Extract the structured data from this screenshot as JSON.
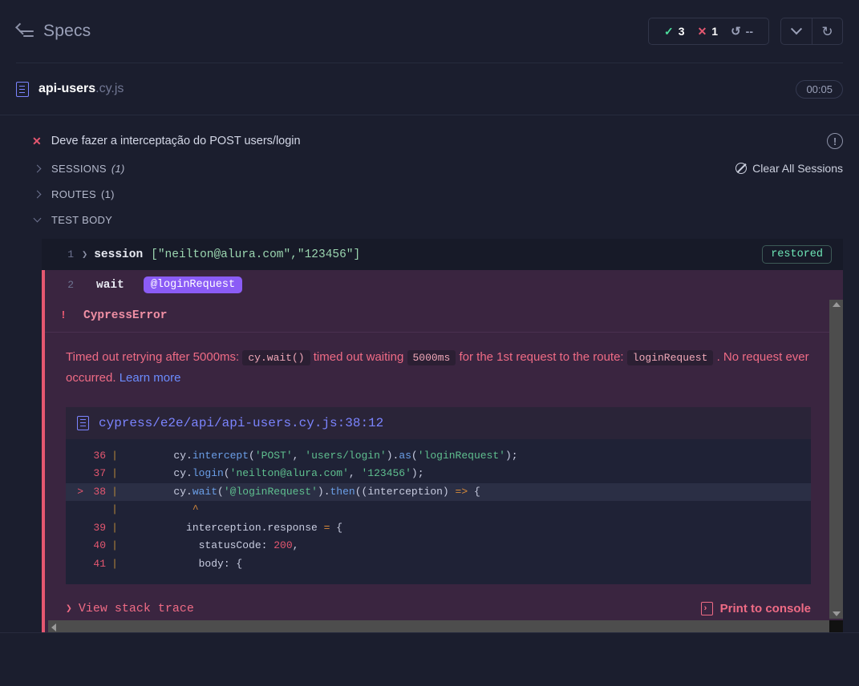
{
  "header": {
    "back_label": "Specs",
    "back_icon": "back-to-specs-icon",
    "stats": {
      "passed_glyph": "✓",
      "passed_count": "3",
      "failed_glyph": "✕",
      "failed_count": "1",
      "pending_glyph": "↺",
      "pending_count": "--"
    },
    "chevron_icon": "chevron-down-icon",
    "reload_glyph": "↻",
    "colors": {
      "passed": "#4ddd9c",
      "failed": "#e45770",
      "pending": "#9aa0b8"
    }
  },
  "spec": {
    "file_icon": "spec-file-icon",
    "name": "api-users",
    "extension": ".cy.js",
    "duration": "00:05"
  },
  "test": {
    "status_glyph": "✕",
    "title": "Deve fazer a interceptação do POST users/login",
    "info_icon": "info-circle-icon",
    "sections": [
      {
        "label": "SESSIONS",
        "count": "(1)",
        "count_italic": true,
        "expanded": false
      },
      {
        "label": "ROUTES",
        "count": "(1)",
        "count_italic": false,
        "expanded": false
      },
      {
        "label": "TEST BODY",
        "count": "",
        "count_italic": false,
        "expanded": true
      }
    ],
    "clear_sessions_label": "Clear All Sessions",
    "clear_sessions_icon": "no-entry-icon"
  },
  "commands": [
    {
      "number": "1",
      "caret": "❯",
      "name": "session",
      "args": "[\"neilton@alura.com\",\"123456\"]",
      "badge": "restored",
      "alias": "",
      "state": "normal"
    },
    {
      "number": "2",
      "caret": "",
      "name": "wait",
      "args": "",
      "badge": "",
      "alias": "@loginRequest",
      "state": "failed"
    }
  ],
  "error": {
    "bang": "!",
    "type": "CypressError",
    "message_parts": [
      {
        "text": "Timed out retrying after 5000ms: ",
        "kind": "text"
      },
      {
        "text": "cy.wait()",
        "kind": "code"
      },
      {
        "text": " timed out waiting ",
        "kind": "text"
      },
      {
        "text": "5000ms",
        "kind": "code"
      },
      {
        "text": " for the 1st request to the route: ",
        "kind": "text"
      },
      {
        "text": "loginRequest",
        "kind": "code"
      },
      {
        "text": " . No request ever occurred. ",
        "kind": "text"
      },
      {
        "text": "Learn more",
        "kind": "link"
      }
    ],
    "file_link": "cypress/e2e/api/api-users.cy.js:38:12",
    "file_link_icon": "file-icon",
    "code_lines": [
      {
        "marker": "",
        "num": "36",
        "highlight": false,
        "tokens": [
          {
            "t": "        cy.",
            "c": "plain"
          },
          {
            "t": "intercept",
            "c": "prop"
          },
          {
            "t": "(",
            "c": "plain"
          },
          {
            "t": "'POST'",
            "c": "str"
          },
          {
            "t": ", ",
            "c": "plain"
          },
          {
            "t": "'users/login'",
            "c": "str"
          },
          {
            "t": ").",
            "c": "plain"
          },
          {
            "t": "as",
            "c": "prop"
          },
          {
            "t": "(",
            "c": "plain"
          },
          {
            "t": "'loginRequest'",
            "c": "str"
          },
          {
            "t": ");",
            "c": "plain"
          }
        ]
      },
      {
        "marker": "",
        "num": "37",
        "highlight": false,
        "tokens": [
          {
            "t": "        cy.",
            "c": "plain"
          },
          {
            "t": "login",
            "c": "prop"
          },
          {
            "t": "(",
            "c": "plain"
          },
          {
            "t": "'neilton@alura.com'",
            "c": "str"
          },
          {
            "t": ", ",
            "c": "plain"
          },
          {
            "t": "'123456'",
            "c": "str"
          },
          {
            "t": ");",
            "c": "plain"
          }
        ]
      },
      {
        "marker": ">",
        "num": "38",
        "highlight": true,
        "tokens": [
          {
            "t": "        cy.",
            "c": "plain"
          },
          {
            "t": "wait",
            "c": "prop"
          },
          {
            "t": "(",
            "c": "plain"
          },
          {
            "t": "'@loginRequest'",
            "c": "str"
          },
          {
            "t": ").",
            "c": "plain"
          },
          {
            "t": "then",
            "c": "prop"
          },
          {
            "t": "((interception) ",
            "c": "plain"
          },
          {
            "t": "=>",
            "c": "op"
          },
          {
            "t": " {",
            "c": "plain"
          }
        ]
      },
      {
        "marker": "",
        "num": "",
        "highlight": false,
        "caret": true,
        "tokens": [
          {
            "t": "           ^",
            "c": "op"
          }
        ]
      },
      {
        "marker": "",
        "num": "39",
        "highlight": false,
        "tokens": [
          {
            "t": "          interception.response ",
            "c": "plain"
          },
          {
            "t": "=",
            "c": "op"
          },
          {
            "t": " {",
            "c": "plain"
          }
        ]
      },
      {
        "marker": "",
        "num": "40",
        "highlight": false,
        "tokens": [
          {
            "t": "            statusCode: ",
            "c": "plain"
          },
          {
            "t": "200",
            "c": "num"
          },
          {
            "t": ",",
            "c": "plain"
          }
        ]
      },
      {
        "marker": "",
        "num": "41",
        "highlight": false,
        "tokens": [
          {
            "t": "            body: {",
            "c": "plain"
          }
        ]
      }
    ],
    "stack_trace_label": "View stack trace",
    "stack_trace_chevron": "❯",
    "print_console_label": "Print to console",
    "print_console_icon": "print-to-console-icon"
  }
}
